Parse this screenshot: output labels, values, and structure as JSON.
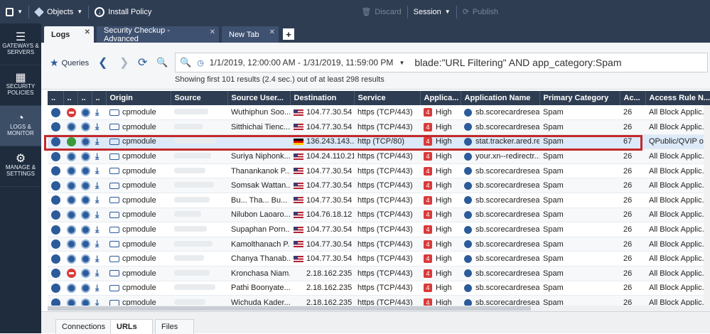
{
  "topbar": {
    "objects": "Objects",
    "install_policy": "Install Policy",
    "discard": "Discard",
    "session": "Session",
    "publish": "Publish"
  },
  "sidebar": [
    {
      "label": "GATEWAYS & SERVERS",
      "icon": "server-icon"
    },
    {
      "label": "SECURITY POLICIES",
      "icon": "grid-icon"
    },
    {
      "label": "LOGS & MONITOR",
      "icon": "gauge-icon",
      "active": true
    },
    {
      "label": "MANAGE & SETTINGS",
      "icon": "gear-icon"
    }
  ],
  "tabs": [
    {
      "label": "Logs",
      "active": true
    },
    {
      "label": "Security Checkup - Advanced"
    },
    {
      "label": "New Tab"
    }
  ],
  "toolbar": {
    "queries": "Queries",
    "time_range": "1/1/2019, 12:00:00 AM - 1/31/2019, 11:59:00 PM",
    "query": "blade:\"URL Filtering\" AND app_category:Spam",
    "result_info": "Showing first 101 results (2.4 sec.) out of at least 298 results"
  },
  "columns": [
    "..",
    "..",
    "..",
    "..",
    "Origin",
    "Source",
    "Source User...",
    "Destination",
    "Service",
    "Applica...",
    "Application Name",
    "Primary Category",
    "Ac...",
    "Access Rule N..."
  ],
  "rows": [
    {
      "action": "block",
      "origin": "cpmodule",
      "user": "Wuthiphun Soo...",
      "flag": "us",
      "dest": "104.77.30.54",
      "service": "https (TCP/443)",
      "risk": "4",
      "level": "High",
      "app": "sb.scorecardresea...",
      "cat": "Spam",
      "ac": "26",
      "rule": "All Block Applic..."
    },
    {
      "action": "redirect",
      "origin": "cpmodule",
      "user": "Sitthichai Tienc...",
      "flag": "us",
      "dest": "104.77.30.54",
      "service": "https (TCP/443)",
      "risk": "4",
      "level": "High",
      "app": "sb.scorecardresea...",
      "cat": "Spam",
      "ac": "26",
      "rule": "All Block Applic..."
    },
    {
      "action": "accept",
      "origin": "cpmodule",
      "user": "",
      "flag": "de",
      "dest": "136.243.143....",
      "service": "http (TCP/80)",
      "risk": "4",
      "level": "High",
      "app": "stat.tracker.ared.re",
      "cat": "Spam",
      "ac": "67",
      "rule": "QPublic/QVIP o...",
      "selected": true
    },
    {
      "action": "redirect",
      "origin": "cpmodule",
      "user": "Suriya Niphonk...",
      "flag": "us",
      "dest": "104.24.110.218",
      "service": "https (TCP/443)",
      "risk": "4",
      "level": "High",
      "app": "your.xn--redirectr...",
      "cat": "Spam",
      "ac": "26",
      "rule": "All Block Applic..."
    },
    {
      "action": "redirect",
      "origin": "cpmodule",
      "user": "Thanankanok P...",
      "flag": "us",
      "dest": "104.77.30.54",
      "service": "https (TCP/443)",
      "risk": "4",
      "level": "High",
      "app": "sb.scorecardresea...",
      "cat": "Spam",
      "ac": "26",
      "rule": "All Block Applic..."
    },
    {
      "action": "redirect",
      "origin": "cpmodule",
      "user": "Somsak Wattan...",
      "flag": "us",
      "dest": "104.77.30.54",
      "service": "https (TCP/443)",
      "risk": "4",
      "level": "High",
      "app": "sb.scorecardresea...",
      "cat": "Spam",
      "ac": "26",
      "rule": "All Block Applic..."
    },
    {
      "action": "redirect",
      "origin": "cpmodule",
      "user": "Bu... Tha... Bu...",
      "flag": "us",
      "dest": "104.77.30.54",
      "service": "https (TCP/443)",
      "risk": "4",
      "level": "High",
      "app": "sb.scorecardresea...",
      "cat": "Spam",
      "ac": "26",
      "rule": "All Block Applic..."
    },
    {
      "action": "redirect",
      "origin": "cpmodule",
      "user": "Nilubon Laoaro...",
      "flag": "us",
      "dest": "104.76.18.12",
      "service": "https (TCP/443)",
      "risk": "4",
      "level": "High",
      "app": "sb.scorecardresea...",
      "cat": "Spam",
      "ac": "26",
      "rule": "All Block Applic..."
    },
    {
      "action": "redirect",
      "origin": "cpmodule",
      "user": "Supaphan Porn...",
      "flag": "us",
      "dest": "104.77.30.54",
      "service": "https (TCP/443)",
      "risk": "4",
      "level": "High",
      "app": "sb.scorecardresea...",
      "cat": "Spam",
      "ac": "26",
      "rule": "All Block Applic..."
    },
    {
      "action": "redirect",
      "origin": "cpmodule",
      "user": "Kamolthanach P...",
      "flag": "us",
      "dest": "104.77.30.54",
      "service": "https (TCP/443)",
      "risk": "4",
      "level": "High",
      "app": "sb.scorecardresea...",
      "cat": "Spam",
      "ac": "26",
      "rule": "All Block Applic..."
    },
    {
      "action": "redirect",
      "origin": "cpmodule",
      "user": "Chanya Thanab...",
      "flag": "us",
      "dest": "104.77.30.54",
      "service": "https (TCP/443)",
      "risk": "4",
      "level": "High",
      "app": "sb.scorecardresea...",
      "cat": "Spam",
      "ac": "26",
      "rule": "All Block Applic..."
    },
    {
      "action": "block",
      "origin": "cpmodule",
      "user": "Kronchasa Niam...",
      "flag": "none",
      "dest": "2.18.162.235",
      "service": "https (TCP/443)",
      "risk": "4",
      "level": "High",
      "app": "sb.scorecardresea...",
      "cat": "Spam",
      "ac": "26",
      "rule": "All Block Applic..."
    },
    {
      "action": "redirect",
      "origin": "cpmodule",
      "user": "Pathi Boonyate...",
      "flag": "none",
      "dest": "2.18.162.235",
      "service": "https (TCP/443)",
      "risk": "4",
      "level": "High",
      "app": "sb.scorecardresea...",
      "cat": "Spam",
      "ac": "26",
      "rule": "All Block Applic..."
    },
    {
      "action": "redirect",
      "origin": "cpmodule",
      "user": "Wichuda Kader...",
      "flag": "none",
      "dest": "2.18.162.235",
      "service": "https (TCP/443)",
      "risk": "4",
      "level": "High",
      "app": "sb.scorecardresea...",
      "cat": "Spam",
      "ac": "26",
      "rule": "All Block Applic..."
    }
  ],
  "bottom_tabs": [
    {
      "label": "Connections"
    },
    {
      "label": "URLs",
      "active": true
    },
    {
      "label": "Files"
    }
  ]
}
